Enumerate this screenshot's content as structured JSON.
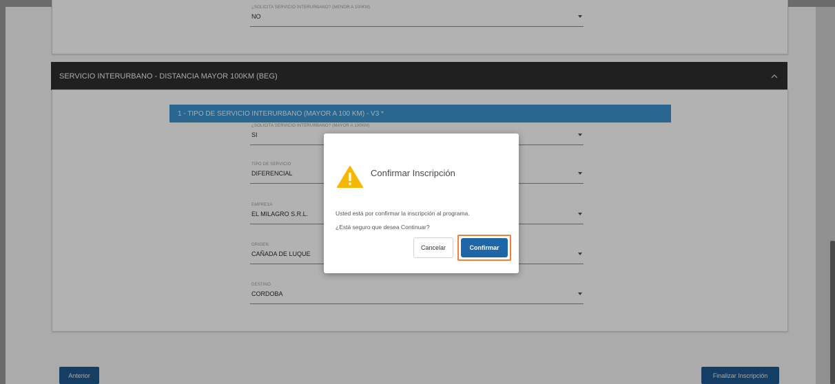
{
  "top_field": {
    "label": "¿SOLICITA SERVICIO INTERURBANO? (MENOR A 100KM)",
    "value": "NO"
  },
  "section": {
    "title": "SERVICIO INTERURBANO - DISTANCIA MAYOR 100KM (BEG)",
    "chevron_icon": "chevron-up"
  },
  "subsection": {
    "title": "1 - TIPO DE SERVICIO INTERURBANO (MAYOR A 100 KM) - V3 *"
  },
  "fields": [
    {
      "label": "¿SOLICITA SERVICIO INTERURBANO? (MAYOR A 100KM)",
      "value": "SI"
    },
    {
      "label": "TIPO DE SERVICIO",
      "value": "DIFERENCIAL"
    },
    {
      "label": "EMPRESA",
      "value": "EL MILAGRO S.R.L."
    },
    {
      "label": "ORIGEN",
      "value": "CAÑADA DE LUQUE"
    },
    {
      "label": "DESTINO",
      "value": "CORDOBA"
    }
  ],
  "footer": {
    "prev_label": "Anterior",
    "finish_label": "Finalizar Inscripción"
  },
  "modal": {
    "title": "Confirmar Inscripción",
    "body_line1": "Usted está por confirmar la inscripción al programa.",
    "body_line2": "¿Está seguro que desea Continuar?",
    "cancel_label": "Cancelar",
    "confirm_label": "Confirmar",
    "icon": "warning-icon"
  },
  "colors": {
    "header_dark": "#2f2f2f",
    "subheader_blue": "#3d94cf",
    "button_blue": "#1e5a8e",
    "warning_yellow": "#f5b800",
    "highlight_orange": "#ef7d3c"
  }
}
